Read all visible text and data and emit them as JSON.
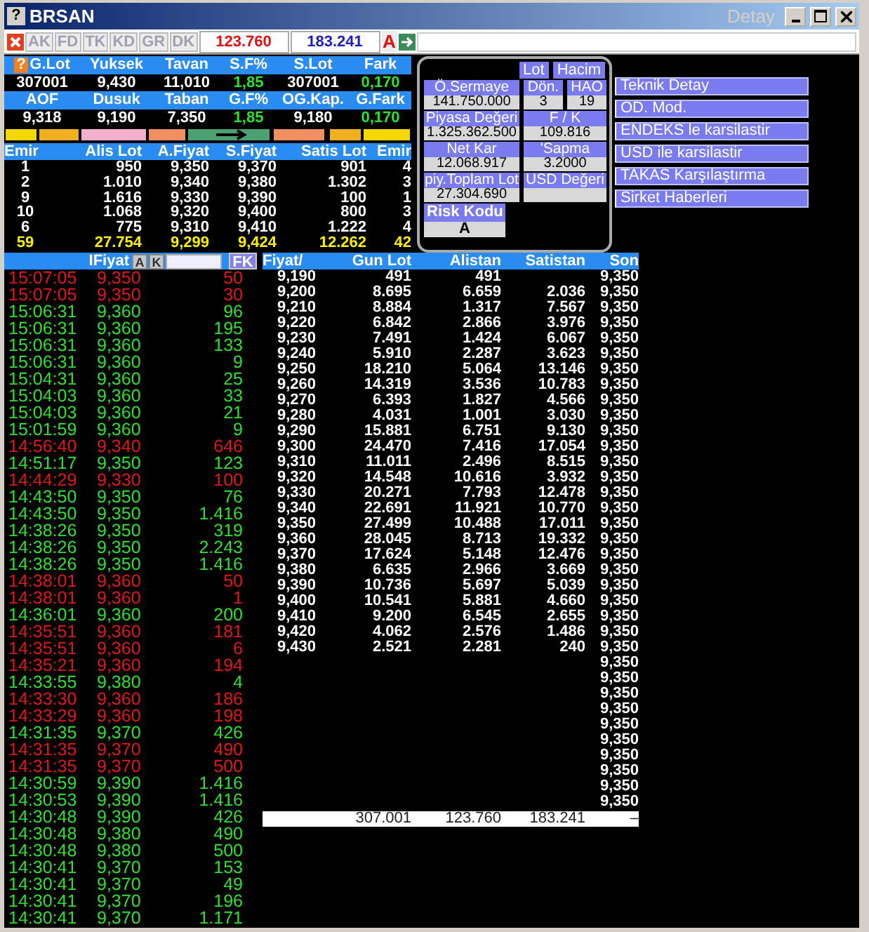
{
  "window": {
    "help_glyph": "?",
    "title": "BRSAN",
    "caption_right": "Detay"
  },
  "toolbar": {
    "tabs": [
      {
        "label": "AK",
        "disabled": true
      },
      {
        "label": "FD",
        "disabled": true
      },
      {
        "label": "TK",
        "disabled": true
      },
      {
        "label": "KD",
        "disabled": true
      },
      {
        "label": "GR",
        "disabled": true
      },
      {
        "label": "DK",
        "disabled": true
      }
    ],
    "buy_total": "123.760",
    "sell_total": "183.241",
    "flag": "A"
  },
  "summary": {
    "help_glyph": "?",
    "blocks": [
      {
        "headers": [
          "G.Lot",
          "Yuksek",
          "Tavan",
          "S.F%",
          "S.Lot",
          "Fark"
        ],
        "values": [
          {
            "text": "307001",
            "kind": "plain"
          },
          {
            "text": "9,430",
            "kind": "plain"
          },
          {
            "text": "11,010",
            "kind": "plain"
          },
          {
            "text": "1,85",
            "kind": "change"
          },
          {
            "text": "307001",
            "kind": "plain"
          },
          {
            "text": "0,170",
            "kind": "change"
          }
        ]
      },
      {
        "headers": [
          "AOF",
          "Dusuk",
          "Taban",
          "G.F%",
          "OG.Kap.",
          "G.Fark"
        ],
        "values": [
          {
            "text": "9,318",
            "kind": "plain"
          },
          {
            "text": "9,190",
            "kind": "plain"
          },
          {
            "text": "7,350",
            "kind": "plain"
          },
          {
            "text": "1,85",
            "kind": "change"
          },
          {
            "text": "9,180",
            "kind": "plain"
          },
          {
            "text": "0,170",
            "kind": "change"
          }
        ]
      }
    ]
  },
  "order_book": {
    "columns": [
      "Emir",
      "Alis Lot",
      "A.Fiyat",
      "S.Fiyat",
      "Satis Lot",
      "Emir"
    ],
    "rows": [
      [
        "1",
        "950",
        "9,350",
        "9,370",
        "901",
        "4"
      ],
      [
        "2",
        "1.010",
        "9,340",
        "9,380",
        "1.302",
        "3"
      ],
      [
        "9",
        "1.616",
        "9,330",
        "9,390",
        "100",
        "1"
      ],
      [
        "10",
        "1.068",
        "9,320",
        "9,400",
        "800",
        "3"
      ],
      [
        "6",
        "775",
        "9,310",
        "9,410",
        "1.222",
        "4"
      ]
    ],
    "totals": [
      "59",
      "27.754",
      "9,299",
      "9,424",
      "12.262",
      "42"
    ]
  },
  "info_panel": {
    "buttons": [
      "Lot",
      "Hacim"
    ],
    "rows": [
      [
        {
          "label": "Ö.Sermaye",
          "value": "141.750.000"
        },
        {
          "label": "Dön.",
          "value": "3"
        },
        {
          "label": "HAO",
          "value": "19"
        }
      ],
      [
        {
          "label": "Piyasa Değeri",
          "value": "1.325.362.500"
        },
        {
          "label": "F / K",
          "value": "109.816"
        }
      ],
      [
        {
          "label": "Net Kar",
          "value": "12.068.917"
        },
        {
          "label": "'Sapma",
          "value": "3.2000"
        }
      ],
      [
        {
          "label": "piy.Toplam Lot",
          "value": "27.304.690"
        },
        {
          "label": "USD Değeri"
        }
      ]
    ],
    "risk": {
      "label": "Risk Kodu",
      "value": "A"
    }
  },
  "menu": [
    "Teknik Detay",
    "OD. Mod.",
    "ENDEKS le karsilastir",
    "USD ile karsilastir",
    "TAKAS Karşılaştırma",
    "Sirket Haberleri"
  ],
  "trades": {
    "header": "IFiyat",
    "buttons": [
      "A",
      "K"
    ],
    "filter_button": "FK",
    "rows": [
      {
        "time": "15:07:05",
        "price": "9,350",
        "lot": "50",
        "falling": true
      },
      {
        "time": "15:07:05",
        "price": "9,350",
        "lot": "30",
        "falling": true
      },
      {
        "time": "15:06:31",
        "price": "9,360",
        "lot": "96",
        "falling": false
      },
      {
        "time": "15:06:31",
        "price": "9,360",
        "lot": "195",
        "falling": false
      },
      {
        "time": "15:06:31",
        "price": "9,360",
        "lot": "133",
        "falling": false
      },
      {
        "time": "15:06:31",
        "price": "9,360",
        "lot": "9",
        "falling": false
      },
      {
        "time": "15:04:31",
        "price": "9,360",
        "lot": "25",
        "falling": false
      },
      {
        "time": "15:04:03",
        "price": "9,360",
        "lot": "33",
        "falling": false
      },
      {
        "time": "15:04:03",
        "price": "9,360",
        "lot": "21",
        "falling": false
      },
      {
        "time": "15:01:59",
        "price": "9,360",
        "lot": "9",
        "falling": false
      },
      {
        "time": "14:56:40",
        "price": "9,340",
        "lot": "646",
        "falling": true
      },
      {
        "time": "14:51:17",
        "price": "9,350",
        "lot": "123",
        "falling": false
      },
      {
        "time": "14:44:29",
        "price": "9,330",
        "lot": "100",
        "falling": true
      },
      {
        "time": "14:43:50",
        "price": "9,350",
        "lot": "76",
        "falling": false
      },
      {
        "time": "14:43:50",
        "price": "9,350",
        "lot": "1.416",
        "falling": false
      },
      {
        "time": "14:38:26",
        "price": "9,350",
        "lot": "319",
        "falling": false
      },
      {
        "time": "14:38:26",
        "price": "9,350",
        "lot": "2.243",
        "falling": false
      },
      {
        "time": "14:38:26",
        "price": "9,350",
        "lot": "1.416",
        "falling": false
      },
      {
        "time": "14:38:01",
        "price": "9,360",
        "lot": "50",
        "falling": true
      },
      {
        "time": "14:38:01",
        "price": "9,360",
        "lot": "1",
        "falling": true
      },
      {
        "time": "14:36:01",
        "price": "9,360",
        "lot": "200",
        "falling": false
      },
      {
        "time": "14:35:51",
        "price": "9,360",
        "lot": "181",
        "falling": true
      },
      {
        "time": "14:35:51",
        "price": "9,360",
        "lot": "6",
        "falling": true
      },
      {
        "time": "14:35:21",
        "price": "9,360",
        "lot": "194",
        "falling": true
      },
      {
        "time": "14:33:55",
        "price": "9,380",
        "lot": "4",
        "falling": false
      },
      {
        "time": "14:33:30",
        "price": "9,360",
        "lot": "186",
        "falling": true
      },
      {
        "time": "14:33:29",
        "price": "9,360",
        "lot": "198",
        "falling": true
      },
      {
        "time": "14:31:35",
        "price": "9,370",
        "lot": "426",
        "falling": false
      },
      {
        "time": "14:31:35",
        "price": "9,370",
        "lot": "490",
        "falling": true
      },
      {
        "time": "14:31:35",
        "price": "9,370",
        "lot": "500",
        "falling": true
      },
      {
        "time": "14:30:59",
        "price": "9,390",
        "lot": "1.416",
        "falling": false
      },
      {
        "time": "14:30:53",
        "price": "9,390",
        "lot": "1.416",
        "falling": false
      },
      {
        "time": "14:30:48",
        "price": "9,390",
        "lot": "426",
        "falling": false
      },
      {
        "time": "14:30:48",
        "price": "9,380",
        "lot": "490",
        "falling": false
      },
      {
        "time": "14:30:48",
        "price": "9,380",
        "lot": "500",
        "falling": false
      },
      {
        "time": "14:30:41",
        "price": "9,370",
        "lot": "153",
        "falling": false
      },
      {
        "time": "14:30:41",
        "price": "9,370",
        "lot": "49",
        "falling": false
      },
      {
        "time": "14:30:41",
        "price": "9,370",
        "lot": "196",
        "falling": false
      },
      {
        "time": "14:30:41",
        "price": "9,370",
        "lot": "1.171",
        "falling": false
      }
    ]
  },
  "price_table": {
    "columns": [
      "Fiyat/",
      "Gun Lot",
      "Alistan",
      "Satistan",
      "Son"
    ],
    "rows": [
      {
        "price": "9,190",
        "gun_lot": "491",
        "alistan": "491",
        "son": "9,350"
      },
      {
        "price": "9,200",
        "gun_lot": "8.695",
        "alistan": "6.659",
        "satistan": "2.036",
        "son": "9,350"
      },
      {
        "price": "9,210",
        "gun_lot": "8.884",
        "alistan": "1.317",
        "satistan": "7.567",
        "son": "9,350"
      },
      {
        "price": "9,220",
        "gun_lot": "6.842",
        "alistan": "2.866",
        "satistan": "3.976",
        "son": "9,350"
      },
      {
        "price": "9,230",
        "gun_lot": "7.491",
        "alistan": "1.424",
        "satistan": "6.067",
        "son": "9,350"
      },
      {
        "price": "9,240",
        "gun_lot": "5.910",
        "alistan": "2.287",
        "satistan": "3.623",
        "son": "9,350"
      },
      {
        "price": "9,250",
        "gun_lot": "18.210",
        "alistan": "5.064",
        "satistan": "13.146",
        "son": "9,350"
      },
      {
        "price": "9,260",
        "gun_lot": "14.319",
        "alistan": "3.536",
        "satistan": "10.783",
        "son": "9,350"
      },
      {
        "price": "9,270",
        "gun_lot": "6.393",
        "alistan": "1.827",
        "satistan": "4.566",
        "son": "9,350"
      },
      {
        "price": "9,280",
        "gun_lot": "4.031",
        "alistan": "1.001",
        "satistan": "3.030",
        "son": "9,350"
      },
      {
        "price": "9,290",
        "gun_lot": "15.881",
        "alistan": "6.751",
        "satistan": "9.130",
        "son": "9,350"
      },
      {
        "price": "9,300",
        "gun_lot": "24.470",
        "alistan": "7.416",
        "satistan": "17.054",
        "son": "9,350"
      },
      {
        "price": "9,310",
        "gun_lot": "11.011",
        "alistan": "2.496",
        "satistan": "8.515",
        "son": "9,350"
      },
      {
        "price": "9,320",
        "gun_lot": "14.548",
        "alistan": "10.616",
        "satistan": "3.932",
        "son": "9,350"
      },
      {
        "price": "9,330",
        "gun_lot": "20.271",
        "alistan": "7.793",
        "satistan": "12.478",
        "son": "9,350"
      },
      {
        "price": "9,340",
        "gun_lot": "22.691",
        "alistan": "11.921",
        "satistan": "10.770",
        "son": "9,350"
      },
      {
        "price": "9,350",
        "gun_lot": "27.499",
        "alistan": "10.488",
        "satistan": "17.011",
        "son": "9,350"
      },
      {
        "price": "9,360",
        "gun_lot": "28.045",
        "alistan": "8.713",
        "satistan": "19.332",
        "son": "9,350"
      },
      {
        "price": "9,370",
        "gun_lot": "17.624",
        "alistan": "5.148",
        "satistan": "12.476",
        "son": "9,350"
      },
      {
        "price": "9,380",
        "gun_lot": "6.635",
        "alistan": "2.966",
        "satistan": "3.669",
        "son": "9,350"
      },
      {
        "price": "9,390",
        "gun_lot": "10.736",
        "alistan": "5.697",
        "satistan": "5.039",
        "son": "9,350"
      },
      {
        "price": "9,400",
        "gun_lot": "10.541",
        "alistan": "5.881",
        "satistan": "4.660",
        "son": "9,350"
      },
      {
        "price": "9,410",
        "gun_lot": "9.200",
        "alistan": "6.545",
        "satistan": "2.655",
        "son": "9,350"
      },
      {
        "price": "9,420",
        "gun_lot": "4.062",
        "alistan": "2.576",
        "satistan": "1.486",
        "son": "9,350"
      },
      {
        "price": "9,430",
        "gun_lot": "2.521",
        "alistan": "2.281",
        "satistan": "240",
        "son": "9,350"
      },
      {
        "son": "9,350"
      },
      {
        "son": "9,350"
      },
      {
        "son": "9,350"
      },
      {
        "son": "9,350"
      },
      {
        "son": "9,350"
      },
      {
        "son": "9,350"
      },
      {
        "son": "9,350"
      },
      {
        "son": "9,350"
      },
      {
        "son": "9,350"
      },
      {
        "son": "9,350"
      }
    ],
    "totals": {
      "gun_lot": "307.001",
      "alistan": "123.760",
      "satistan": "183.241",
      "son": "–"
    }
  }
}
